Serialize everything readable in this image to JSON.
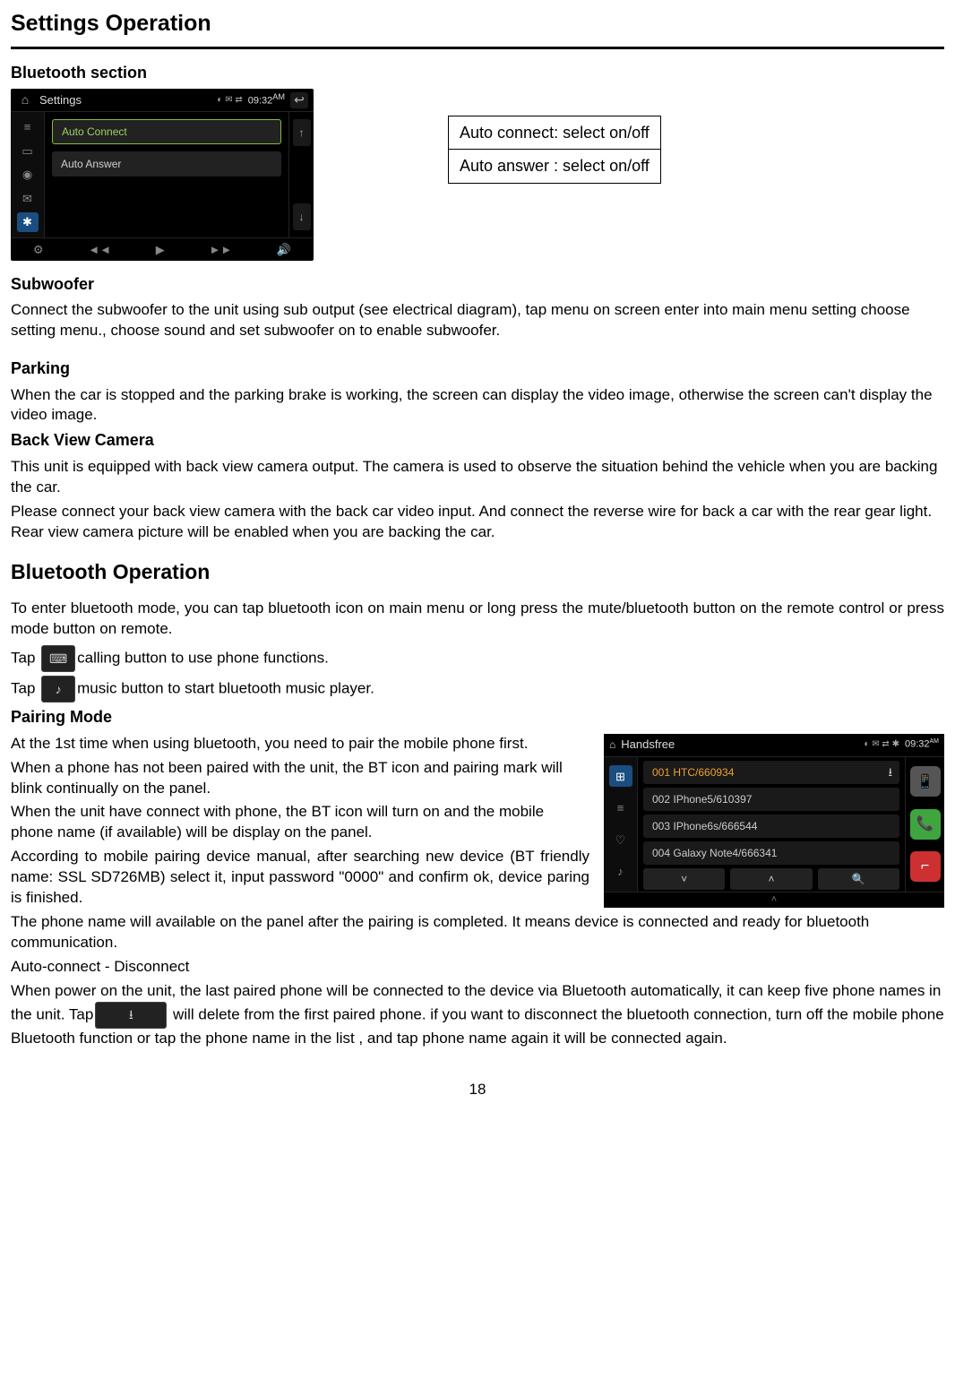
{
  "page_title": "Settings Operation",
  "bluetooth_section_heading": "Bluetooth section",
  "settings_shot": {
    "home_icon": "⌂",
    "title": "Settings",
    "status_icons": "◐ ✉ ⇄",
    "clock": "09:32",
    "clock_ampm": "AM",
    "back_icon": "↩",
    "side": {
      "eq": "≡",
      "display": "▭",
      "sound": "◉",
      "mail": "✉",
      "bt": "✱"
    },
    "opt1": "Auto Connect",
    "opt2": "Auto Answer",
    "scroll_up": "↑",
    "scroll_down": "↓",
    "bottom": {
      "gear": "⚙",
      "prev": "◄◄",
      "play": "▶",
      "next": "►►",
      "vol": "🔊"
    }
  },
  "info_table": {
    "row1": "Auto connect: select on/off",
    "row2": "Auto answer : select on/off"
  },
  "subwoofer_heading": "Subwoofer",
  "subwoofer_body": "Connect the subwoofer to the unit using sub output (see electrical diagram), tap menu on screen enter into main menu setting choose setting menu., choose sound and set subwoofer on to enable subwoofer.",
  "parking_heading": "Parking",
  "parking_body": "When the car is stopped and the parking brake is working, the screen can display the video image, otherwise the screen can't display the video image.",
  "backcam_heading": "Back View Camera",
  "backcam_p1": "This unit is equipped with back view camera output. The camera is used to observe the situation behind the vehicle when you are backing the car.",
  "backcam_p2": "Please connect your back view camera with the back car video input. And connect the reverse wire for back a car with the rear gear light. Rear view camera picture will be enabled when you are backing the car.",
  "bt_operation_heading": "Bluetooth Operation",
  "bt_enter": "To enter  bluetooth mode, you can tap bluetooth icon on main menu or long press the mute/bluetooth button on the remote control or press mode button on remote.",
  "tap_prefix": "Tap ",
  "tap_call_suffix": "calling button to use phone functions.",
  "tap_music_suffix": "music button to start bluetooth music player.",
  "call_icon_glyph": "⌨",
  "music_icon_glyph": "♪",
  "pairing_heading": "Pairing Mode",
  "pairing_p1": "At the 1st time when using bluetooth, you need to pair the mobile phone first.",
  "pairing_p2": "When a phone has not been paired with the unit, the BT icon and pairing mark will blink continually on the panel.",
  "pairing_p3": "When the unit have connect with phone, the BT icon will turn on and the mobile phone name (if available) will be display on the panel.",
  "pairing_p4": "According to mobile pairing device manual, after searching new device (BT friendly name: SSL SD726MB) select it, input password \"0000\" and confirm ok, device paring is finished.",
  "pairing_p5": "The phone name will available on the panel after the pairing is completed. It means device is connected and ready for bluetooth communication.",
  "auto_disc_heading": "Auto-connect - Disconnect",
  "auto_disc_p1a": "When power on the unit, the last paired phone will be connected to the device via Bluetooth automatically, it can keep five phone names in the unit. Tap",
  "delete_icon_glyph": "⭳",
  "auto_disc_p1b": " will delete from the first paired phone. if you want to disconnect the bluetooth connection, turn off the mobile phone Bluetooth function or tap the phone name in the list , and tap phone name again it will be connected again.",
  "hf_shot": {
    "home_icon": "⌂",
    "title": "Handsfree",
    "status_icons": "◐ ✉ ⇄ ✱",
    "clock": "09:32",
    "clock_ampm": "AM",
    "side": {
      "grid": "⊞",
      "list": "≡",
      "fav": "♡",
      "music": "♪"
    },
    "items": [
      "001 HTC/660934",
      "002 IPhone5/610397",
      "003 IPhone6s/666544",
      "004 Galaxy Note4/666341"
    ],
    "download_icon": "⭳",
    "nav_down": "˅",
    "nav_up": "˄",
    "nav_search": "🔍",
    "right": {
      "phone": "📱",
      "call": "📞",
      "end": "⌐"
    },
    "bottom_caret": "˄"
  },
  "page_number": "18"
}
